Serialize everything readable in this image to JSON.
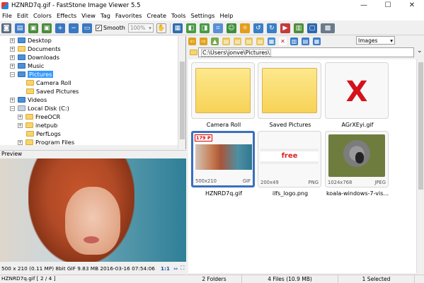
{
  "window": {
    "title": "HZNRD7q.gif - FastStone Image Viewer 5.5",
    "minimize": "—",
    "maximize": "☐",
    "close": "✕"
  },
  "menu": [
    "File",
    "Edit",
    "Colors",
    "Effects",
    "View",
    "Tag",
    "Favorites",
    "Create",
    "Tools",
    "Settings",
    "Help"
  ],
  "toolbar": {
    "smooth_label": "Smooth",
    "smooth_checked": "✓",
    "zoom_value": "100%",
    "zoom_caret": "▾"
  },
  "tree": {
    "items": [
      {
        "label": "Desktop",
        "expander": "+"
      },
      {
        "label": "Documents",
        "expander": "+"
      },
      {
        "label": "Downloads",
        "expander": "+"
      },
      {
        "label": "Music",
        "expander": "+"
      },
      {
        "label": "Pictures",
        "expander": "−"
      },
      {
        "label": "Camera Roll",
        "expander": ""
      },
      {
        "label": "Saved Pictures",
        "expander": ""
      },
      {
        "label": "Videos",
        "expander": "+"
      },
      {
        "label": "Local Disk (C:)",
        "expander": "−"
      },
      {
        "label": "FreeOCR",
        "expander": "+"
      },
      {
        "label": "inetpub",
        "expander": "+"
      },
      {
        "label": "PerfLogs",
        "expander": ""
      },
      {
        "label": "Program Files",
        "expander": "+"
      }
    ]
  },
  "preview": {
    "header": "Preview",
    "info": "500 x 210 (0.11 MP)  8bit  GIF   9.83 MB   2016-03-16 07:54:06",
    "ratio": "1:1"
  },
  "right": {
    "filter": "Images",
    "filter_caret": "▾",
    "address": "C:\\Users\\jonve\\Pictures\\",
    "address_caret": "⌄"
  },
  "thumbnails": [
    {
      "caption": "Camera Roll"
    },
    {
      "caption": "Saved Pictures"
    },
    {
      "caption": "AGrXEyi.gif",
      "mark": "X"
    },
    {
      "caption": "HZNRD7q.gif",
      "dims": "500x210",
      "type": "GIF",
      "badge": "179 P"
    },
    {
      "caption": "ilfs_logo.png",
      "dims": "200x49",
      "type": "PNG",
      "logo_text": "free"
    },
    {
      "caption": "koala-windows-7-vis...",
      "dims": "1024x768",
      "type": "JPEG"
    }
  ],
  "status": {
    "file": "HZNRD7q.gif [ 2 / 4 ]",
    "folders": "2 Folders",
    "files": "4 Files (10.9 MB)",
    "selected": "1 Selected"
  }
}
